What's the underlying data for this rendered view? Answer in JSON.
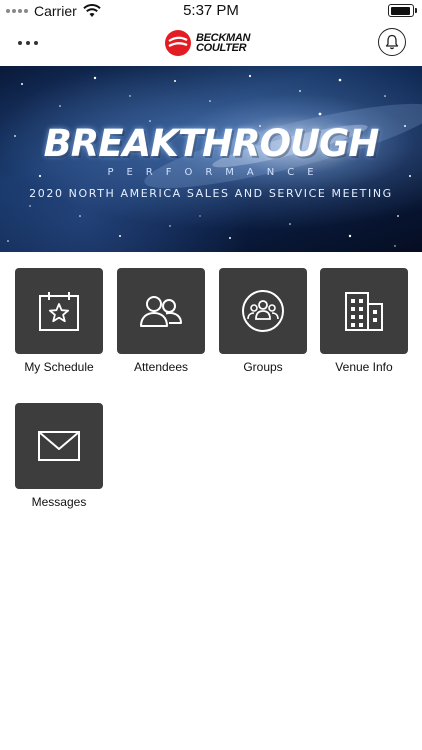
{
  "status_bar": {
    "carrier": "Carrier",
    "time": "5:37 PM"
  },
  "header": {
    "more_icon": "more-dots-icon",
    "logo_line1": "BECKMAN",
    "logo_line2": "COULTER",
    "bell_icon": "bell-icon"
  },
  "banner": {
    "title": "BREAKTHROUGH",
    "subtitle": "PERFORMANCE",
    "meeting": "2020 NORTH AMERICA SALES AND SERVICE MEETING"
  },
  "tiles": [
    {
      "label": "My Schedule",
      "icon": "calendar-star-icon"
    },
    {
      "label": "Attendees",
      "icon": "people-icon"
    },
    {
      "label": "Groups",
      "icon": "group-circle-icon"
    },
    {
      "label": "Venue Info",
      "icon": "building-icon"
    },
    {
      "label": "Messages",
      "icon": "envelope-icon"
    }
  ],
  "colors": {
    "tile_background": "#3d3d3d",
    "logo_red": "#e31b23",
    "banner_dark_blue": "#0b1f45"
  }
}
